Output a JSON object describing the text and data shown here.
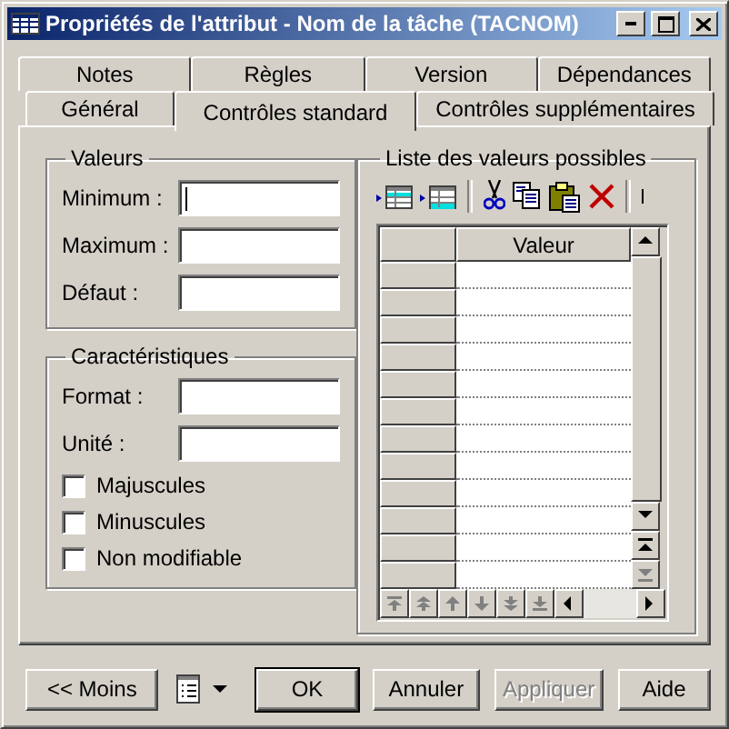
{
  "window": {
    "title": "Propriétés de l'attribut - Nom de la tâche (TACNOM)"
  },
  "tab_rows": [
    [
      {
        "label": "Notes",
        "selected": false
      },
      {
        "label": "Règles",
        "selected": false
      },
      {
        "label": "Version",
        "selected": false
      },
      {
        "label": "Dépendances",
        "selected": false
      }
    ],
    [
      {
        "label": "Général",
        "selected": false
      },
      {
        "label": "Contrôles standard",
        "selected": true
      },
      {
        "label": "Contrôles supplémentaires",
        "selected": false
      }
    ]
  ],
  "values_group": {
    "title": "Valeurs",
    "fields": [
      {
        "label": "Minimum :",
        "focused": true
      },
      {
        "label": "Maximum :",
        "focused": false
      },
      {
        "label": "Défaut :",
        "focused": false
      }
    ]
  },
  "characteristics_group": {
    "title": "Caractéristiques",
    "fields": [
      {
        "label": "Format :",
        "focused": false
      },
      {
        "label": "Unité :",
        "focused": false
      }
    ],
    "checkboxes": [
      {
        "label": "Majuscules",
        "checked": false
      },
      {
        "label": "Minuscules",
        "checked": false
      },
      {
        "label": "Non modifiable",
        "checked": false
      }
    ]
  },
  "values_list": {
    "title": "Liste des valeurs possibles",
    "column": "Valeur"
  },
  "buttons": [
    {
      "kind": "text",
      "label": "<< Moins",
      "default": false,
      "disabled": false
    },
    {
      "kind": "menu"
    },
    {
      "kind": "text",
      "label": "OK",
      "default": true,
      "disabled": false
    },
    {
      "kind": "text",
      "label": "Annuler",
      "default": false,
      "disabled": false
    },
    {
      "kind": "text",
      "label": "Appliquer",
      "default": false,
      "disabled": true
    },
    {
      "kind": "text",
      "label": "Aide",
      "default": false,
      "disabled": false
    }
  ]
}
